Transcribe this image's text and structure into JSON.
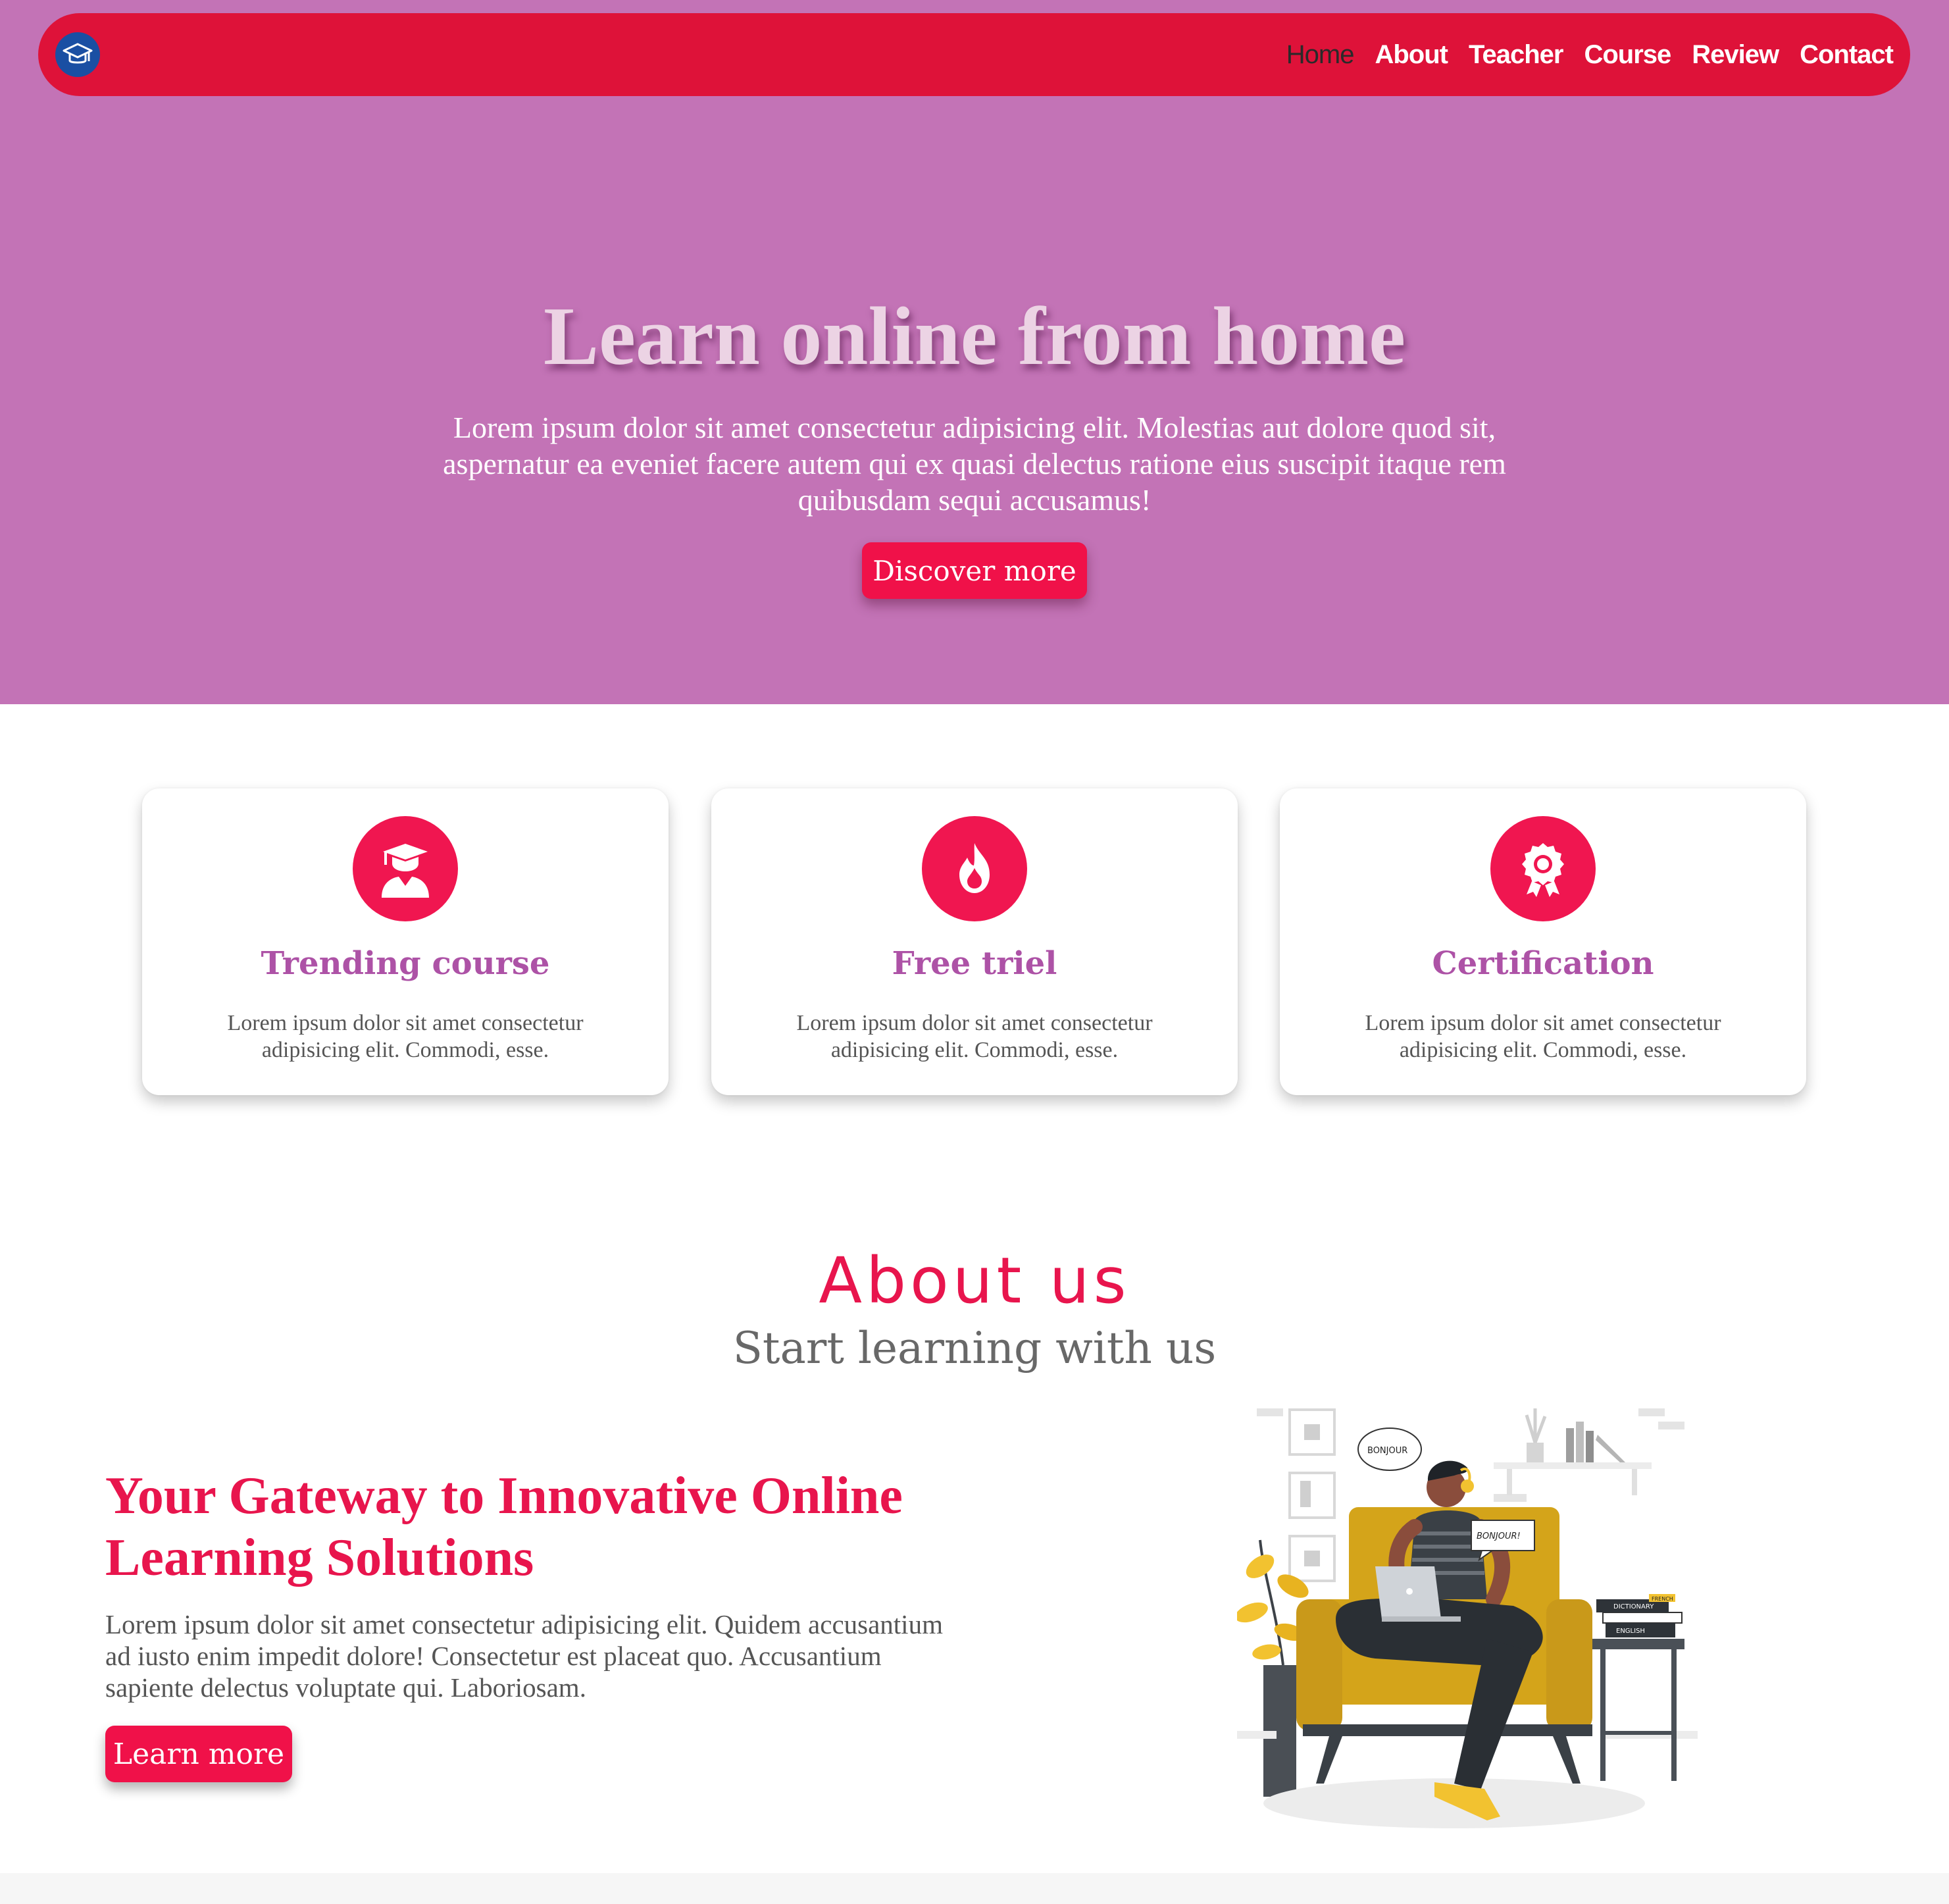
{
  "nav": {
    "links": [
      "Home",
      "About",
      "Teacher",
      "Course",
      "Review",
      "Contact"
    ]
  },
  "hero": {
    "title": "Learn online from home",
    "text": "Lorem ipsum dolor sit amet consectetur adipisicing elit. Molestias aut dolore quod sit, aspernatur ea eveniet facere autem qui ex quasi delectus ratione eius suscipit itaque rem quibusdam sequi accusamus!",
    "button": "Discover more"
  },
  "features": [
    {
      "icon": "graduate-icon",
      "title": "Trending course",
      "text": "Lorem ipsum dolor sit amet consectetur adipisicing elit. Commodi, esse."
    },
    {
      "icon": "fire-icon",
      "title": "Free triel",
      "text": "Lorem ipsum dolor sit amet consectetur adipisicing elit. Commodi, esse."
    },
    {
      "icon": "award-icon",
      "title": "Certification",
      "text": "Lorem ipsum dolor sit amet consectetur adipisicing elit. Commodi, esse."
    }
  ],
  "about": {
    "heading": "About us",
    "subheading": "Start learning with us",
    "title": "Your Gateway to Innovative Online Learning Solutions",
    "text": "Lorem ipsum dolor sit amet consectetur adipisicing elit. Quidem accusantium ad iusto enim impedit dolore! Consectetur est placeat quo. Accusantium sapiente delectus voluptate qui. Laboriosam.",
    "button": "Learn more",
    "illustration": {
      "speech_1": "BONJOUR",
      "speech_2": "BONJOUR!",
      "book_1": "FRENCH",
      "book_2": "DICTIONARY",
      "book_3": "ENGLISH"
    }
  },
  "colors": {
    "hero_bg": "#c373b6",
    "navbar": "#de1239",
    "accent": "#f01149",
    "card_title": "#ad52a6",
    "logo": "#1a4fa3"
  }
}
